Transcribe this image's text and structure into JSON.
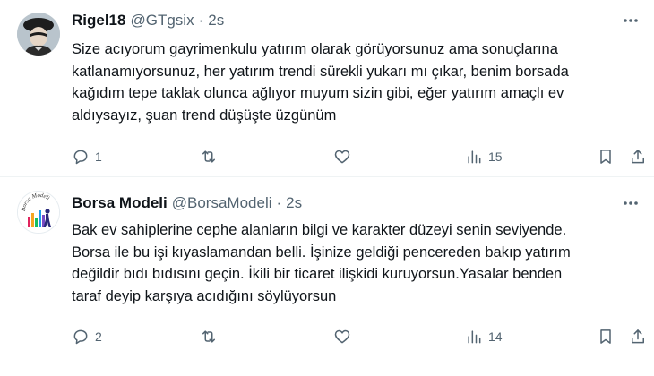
{
  "tweets": [
    {
      "name": "Rigel18",
      "handle": "@GTgsix",
      "separator": "·",
      "time": "2s",
      "lines": [
        "Size acıyorum gayrimenkulu yatırım olarak görüyorsunuz ama sonuçlarına",
        "katlanamıyorsunuz, her yatırım trendi sürekli yukarı mı çıkar, benim borsada",
        "kağıdım tepe taklak olunca ağlıyor muyum sizin gibi, eğer yatırım amaçlı ev",
        "aldıysayız, şuan trend düşüşte üzgünüm"
      ],
      "replies": "1",
      "retweets": "",
      "likes": "",
      "views": "15"
    },
    {
      "name": "Borsa Modeli",
      "handle": "@BorsaModeli",
      "separator": "·",
      "time": "2s",
      "avatar_text": "Borsa Modeli",
      "lines": [
        "Bak ev sahiplerine cephe alanların bilgi ve karakter düzeyi senin seviyende.",
        "Borsa ile bu işi kıyaslamandan belli. İşinize geldiği pencereden bakıp yatırım",
        "değildir bıdı bıdısını geçin. İkili bir ticaret ilişkidi kuruyorsun.Yasalar benden",
        "taraf deyip karşıya acıdığını söylüyorsun"
      ],
      "replies": "2",
      "retweets": "",
      "likes": "",
      "views": "14"
    }
  ],
  "icons": {
    "reply": "reply-icon",
    "retweet": "retweet-icon",
    "like": "heart-icon",
    "views": "views-icon",
    "bookmark": "bookmark-icon",
    "share": "share-icon",
    "more": "more-icon"
  },
  "colors": {
    "text": "#0f1419",
    "secondary": "#536471",
    "divider": "#eff3f4"
  }
}
